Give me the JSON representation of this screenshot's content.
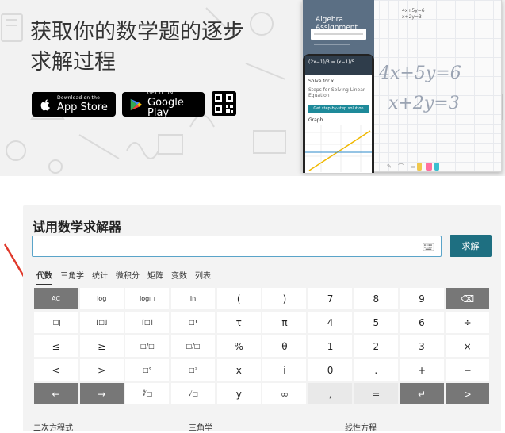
{
  "hero": {
    "title_line1": "获取你的数学题的逐步",
    "title_line2": "求解过程",
    "app_store": {
      "small": "Download on the",
      "big": "App Store"
    },
    "google_play": {
      "small": "GET IT ON",
      "big": "Google Play"
    },
    "phone": {
      "assignment_title": "Algebra Assignment",
      "solve_label": "Solve for x",
      "steps_label": "Steps for Solving Linear Equation",
      "step_button": "Get step-by-step solution",
      "graph_label": "Graph"
    },
    "whiteboard": {
      "eq1": "4x+5y=6",
      "eq2": "x+2y=3",
      "small_eq": "4x+5y=6\nx+2y=3"
    }
  },
  "solver": {
    "title": "试用数学求解器",
    "input_value": "",
    "solve_label": "求解",
    "tabs": [
      "代数",
      "三角学",
      "统计",
      "微积分",
      "矩阵",
      "变数",
      "列表"
    ],
    "active_tab": 0,
    "keys": [
      [
        "AC",
        "log",
        "log□",
        "ln",
        "(",
        ")",
        "7",
        "8",
        "9",
        "⌫"
      ],
      [
        "|□|",
        "⌊□⌋",
        "⌈□⌉",
        "□!",
        "τ",
        "π",
        "4",
        "5",
        "6",
        "÷"
      ],
      [
        "≤",
        "≥",
        "□/□",
        "□/□",
        "%",
        "θ",
        "1",
        "2",
        "3",
        "×"
      ],
      [
        "<",
        ">",
        "□°",
        "□²",
        "x",
        "i",
        "0",
        ".",
        "+",
        "−"
      ],
      [
        "←",
        "→",
        "∜□",
        "√□",
        "y",
        "∞",
        ",",
        "=",
        "↵",
        "⊳"
      ]
    ],
    "examples": [
      "二次方程式",
      "三角学",
      "线性方程"
    ]
  },
  "colors": {
    "accent": "#1e6f81",
    "dark_key": "#777777",
    "annotation_arrow": "#e0392b"
  }
}
